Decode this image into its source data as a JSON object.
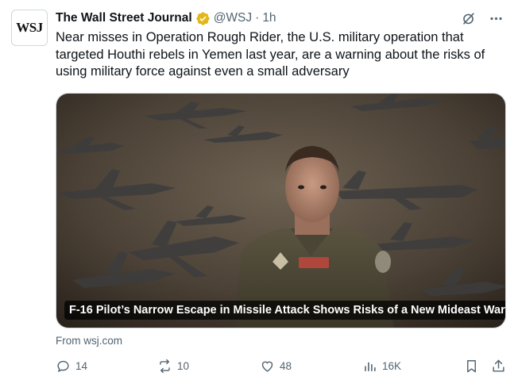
{
  "author": {
    "avatar_text": "WSJ",
    "display_name": "The Wall Street Journal",
    "handle": "@WSJ",
    "separator": "·",
    "time": "1h",
    "verified_badge_color": "#e2b719"
  },
  "tweet": {
    "text": "Near misses in Operation Rough Rider, the U.S. military operation that targeted Houthi rebels in Yemen last year, are a warning about the risks of using military force against even a small adversary"
  },
  "card": {
    "image_description_icon": "pilot-photo",
    "title": "F-16 Pilot’s Narrow Escape in Missile Attack Shows Risks of a New Mideast War",
    "source": "From wsj.com"
  },
  "actions": {
    "replies": "14",
    "reposts": "10",
    "likes": "48",
    "views": "16K"
  },
  "colors": {
    "text_primary": "#0f1419",
    "text_secondary": "#536471",
    "border": "#cfd9de"
  }
}
